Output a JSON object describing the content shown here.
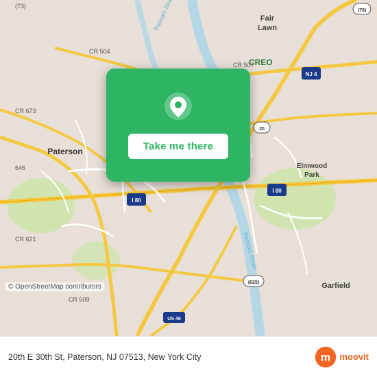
{
  "map": {
    "alt": "Map of Paterson NJ area",
    "background_color": "#e8e0d8",
    "overlay_color": "#2db564"
  },
  "card": {
    "button_label": "Take me there",
    "pin_icon": "location-pin"
  },
  "bottom_bar": {
    "address": "20th E 30th St, Paterson, NJ 07513, New York City",
    "osm_credit": "© OpenStreetMap contributors",
    "logo_name": "moovit",
    "logo_text": "moovit"
  },
  "road_labels": {
    "fair_lawn": "Fair Lawn",
    "paterson": "Paterson",
    "elmwood_park": "Elmwood Park",
    "garfield": "Garfield",
    "cr673": "CR 673",
    "cr504": "CR 504",
    "cr507": "CR 507",
    "nj4": "NJ 4",
    "i80": "I 80",
    "cr621": "CR 621",
    "cr509": "CR 509",
    "cr625": "(625)",
    "i46": "US 46",
    "r76": "(76)",
    "r20": "20"
  }
}
